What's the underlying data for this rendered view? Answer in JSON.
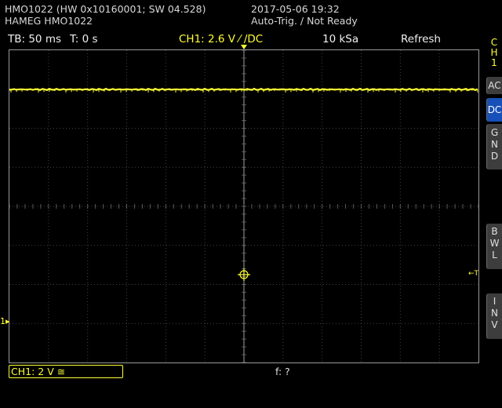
{
  "device": {
    "model_line": "HMO1022 (HW 0x10160001; SW 04.528)",
    "name_line": "HAMEG HMO1022",
    "datetime": "2017-05-06 19:32",
    "trigger_state": "Auto-Trig. / Not Ready"
  },
  "status": {
    "timebase": "TB: 50 ms",
    "trigger_time": "T: 0 s",
    "channel_trigger": "CH1: 2.6 V ⁄ /DC",
    "sample_rate": "10 kSa",
    "mode": "Refresh"
  },
  "side_panel": {
    "channel_label": "C\nH\n1",
    "ac_label": "AC",
    "dc_label": "DC",
    "gnd_label": "G\nN\nD",
    "bwl_label": "B\nW\nL",
    "inv_label": "I\nN\nV"
  },
  "footer": {
    "ch1_scale": "CH1: 2 V ≅",
    "frequency": "f: ?"
  },
  "markers": {
    "ch1_ground": "1",
    "trigger_level": "←T"
  },
  "colors": {
    "trace": "#ffff33",
    "grid": "#7a7a7a",
    "active_coupling": "#1750b8",
    "background": "#000000"
  },
  "icons": {
    "trigger_position": "down-triangle-icon",
    "screen_center": "crosshair-circle-icon",
    "ground_marker": "arrow-right-icon"
  }
}
